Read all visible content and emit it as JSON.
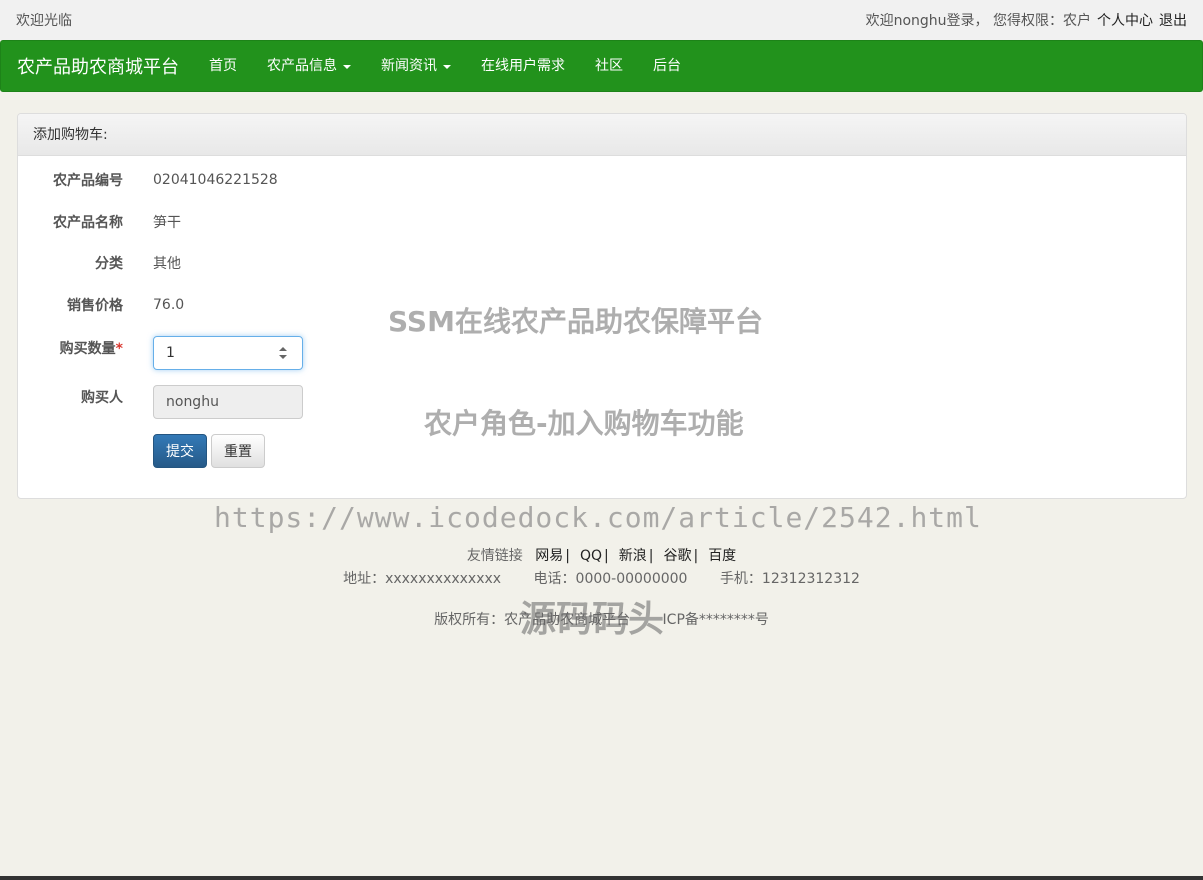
{
  "topbar": {
    "welcome": "欢迎光临",
    "user_text": "欢迎nonghu登录， 您得权限：农户",
    "profile_link": "个人中心",
    "logout_link": "退出"
  },
  "navbar": {
    "brand": "农产品助农商城平台",
    "items": [
      {
        "label": "首页",
        "dropdown": false
      },
      {
        "label": "农产品信息",
        "dropdown": true
      },
      {
        "label": "新闻资讯",
        "dropdown": true
      },
      {
        "label": "在线用户需求",
        "dropdown": false
      },
      {
        "label": "社区",
        "dropdown": false
      },
      {
        "label": "后台",
        "dropdown": false
      }
    ]
  },
  "panel": {
    "heading": "添加购物车:",
    "fields": {
      "code_label": "农产品编号",
      "code_value": "02041046221528",
      "name_label": "农产品名称",
      "name_value": "笋干",
      "category_label": "分类",
      "category_value": "其他",
      "price_label": "销售价格",
      "price_value": "76.0",
      "quantity_label": "购买数量",
      "quantity_required_mark": "*",
      "quantity_value": "1",
      "buyer_label": "购买人",
      "buyer_value": "nonghu"
    },
    "submit_label": "提交",
    "reset_label": "重置"
  },
  "footer": {
    "links_label": "友情链接",
    "links": [
      "网易",
      "QQ",
      "新浪",
      "谷歌",
      "百度"
    ],
    "link_sep": "|",
    "address": "地址：xxxxxxxxxxxxxx",
    "phone": "电话：0000-00000000",
    "mobile": "手机：12312312312",
    "copyright": "版权所有：农产品助农商城平台",
    "icp": "ICP备********号"
  },
  "watermarks": {
    "title": "SSM在线农产品助农保障平台",
    "subtitle": "农户角色-加入购物车功能",
    "url": "https://www.icodedock.com/article/2542.html",
    "brand": "源码码头"
  }
}
